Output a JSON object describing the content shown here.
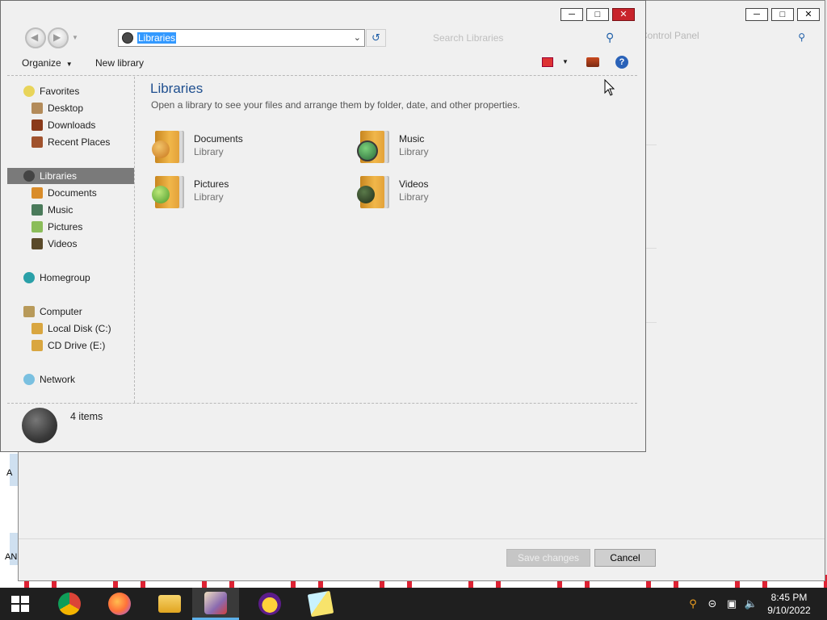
{
  "desktop": {
    "left_edge_labels": [
      "A",
      "AN"
    ]
  },
  "control_panel": {
    "search_placeholder": "Control Panel",
    "save_label": "Save changes",
    "cancel_label": "Cancel"
  },
  "explorer": {
    "address_value": "Libraries",
    "search_placeholder": "Search Libraries",
    "toolbar": {
      "organize": "Organize",
      "new_library": "New library"
    },
    "nav": {
      "favorites": "Favorites",
      "desktop": "Desktop",
      "downloads": "Downloads",
      "recent_places": "Recent Places",
      "libraries": "Libraries",
      "documents": "Documents",
      "music": "Music",
      "pictures": "Pictures",
      "videos": "Videos",
      "homegroup": "Homegroup",
      "computer": "Computer",
      "local_disk": "Local Disk (C:)",
      "cd_drive": "CD Drive (E:)",
      "network": "Network"
    },
    "content": {
      "title": "Libraries",
      "subtitle": "Open a library to see your files and arrange them by folder, date, and other properties.",
      "items": [
        {
          "name": "Documents",
          "kind": "Library"
        },
        {
          "name": "Music",
          "kind": "Library"
        },
        {
          "name": "Pictures",
          "kind": "Library"
        },
        {
          "name": "Videos",
          "kind": "Library"
        }
      ]
    },
    "status": "4 items"
  },
  "taskbar": {
    "time": "8:45 PM",
    "date": "9/10/2022",
    "apps": [
      "chrome-icon",
      "firefox-icon",
      "file-explorer-icon",
      "paint-icon",
      "yahoo-messenger-icon",
      "sticky-notes-icon"
    ]
  },
  "colors": {
    "accent": "#3399ff",
    "title_blue": "#1f4f8f",
    "close_red": "#c8232b",
    "taskbar": "#1f1f1f"
  }
}
